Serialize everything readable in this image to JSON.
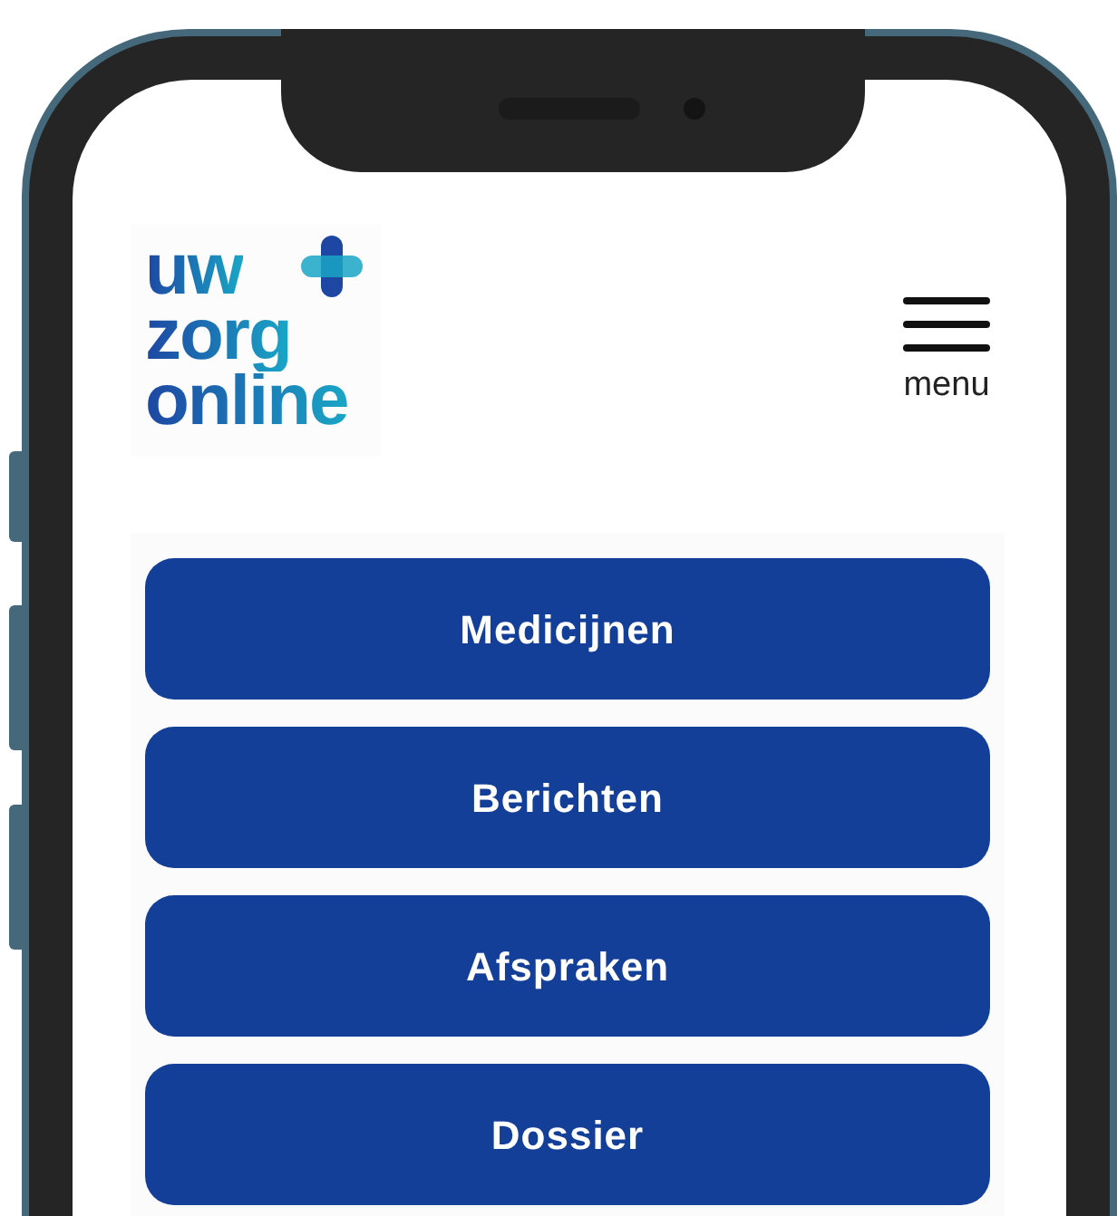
{
  "header": {
    "logo_lines": [
      "uw",
      "zorg",
      "online"
    ],
    "menu_label": "menu"
  },
  "buttons": [
    "Medicijnen",
    "Berichten",
    "Afspraken",
    "Dossier"
  ]
}
